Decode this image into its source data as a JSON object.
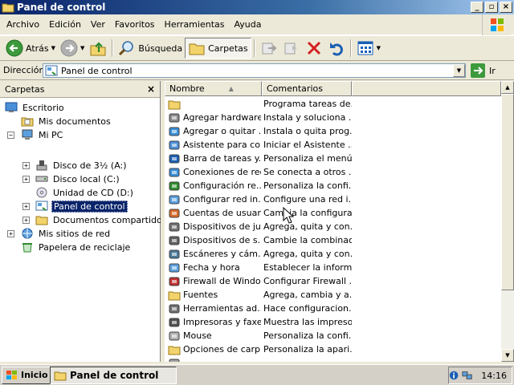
{
  "window": {
    "title": "Panel de control"
  },
  "menubar": {
    "items": [
      "Archivo",
      "Edición",
      "Ver",
      "Favoritos",
      "Herramientas",
      "Ayuda"
    ]
  },
  "toolbar": {
    "back_label": "Atrás",
    "search_label": "Búsqueda",
    "folders_label": "Carpetas"
  },
  "address": {
    "label": "Dirección",
    "value": "Panel de control",
    "go_label": "Ir"
  },
  "folders_pane": {
    "title": "Carpetas",
    "close": "×",
    "items": [
      {
        "label": "Escritorio",
        "icon": "desktop-icon"
      },
      {
        "label": "Mis documentos",
        "icon": "documents-icon"
      },
      {
        "label": "Mi PC",
        "icon": "computer-icon"
      },
      {
        "label": "Disco de 3½ (A:)",
        "icon": "floppy-icon"
      },
      {
        "label": "Disco local (C:)",
        "icon": "drive-icon"
      },
      {
        "label": "Unidad de CD (D:)",
        "icon": "cd-icon"
      },
      {
        "label": "Panel de control",
        "icon": "control-panel-icon",
        "selected": true
      },
      {
        "label": "Documentos compartidos",
        "icon": "folder-icon"
      },
      {
        "label": "Mis sitios de red",
        "icon": "network-icon"
      },
      {
        "label": "Papelera de reciclaje",
        "icon": "recycle-bin-icon"
      }
    ]
  },
  "list": {
    "columns": [
      "Nombre",
      "Comentarios"
    ],
    "rows": [
      {
        "name": "",
        "comment": "Programa tareas de...",
        "icon": "tasks-folder-icon"
      },
      {
        "name": "Agregar hardware",
        "comment": "Instala y soluciona ...",
        "icon": "hardware-icon"
      },
      {
        "name": "Agregar o quitar ...",
        "comment": "Instala o quita prog...",
        "icon": "add-remove-icon"
      },
      {
        "name": "Asistente para co...",
        "comment": "Iniciar el Asistente ...",
        "icon": "wizard-icon"
      },
      {
        "name": "Barra de tareas y...",
        "comment": "Personaliza el menú...",
        "icon": "taskbar-icon"
      },
      {
        "name": "Conexiones de red",
        "comment": "Se conecta a otros ...",
        "icon": "network-connections-icon"
      },
      {
        "name": "Configuración re...",
        "comment": "Personaliza la confi...",
        "icon": "regional-icon"
      },
      {
        "name": "Configurar red in...",
        "comment": "Configure una red i...",
        "icon": "wireless-icon"
      },
      {
        "name": "Cuentas de usuario",
        "comment": "Cambia la configura...",
        "icon": "users-icon"
      },
      {
        "name": "Dispositivos de ju...",
        "comment": "Agrega, quita y con...",
        "icon": "game-controller-icon"
      },
      {
        "name": "Dispositivos de s...",
        "comment": "Cambie la combinaci...",
        "icon": "sound-icon"
      },
      {
        "name": "Escáneres y cám...",
        "comment": "Agrega, quita y con...",
        "icon": "scanner-icon"
      },
      {
        "name": "Fecha y hora",
        "comment": "Establecer la inform...",
        "icon": "clock-icon"
      },
      {
        "name": "Firewall de Windo...",
        "comment": "Configurar Firewall ...",
        "icon": "firewall-icon"
      },
      {
        "name": "Fuentes",
        "comment": "Agrega, cambia y a...",
        "icon": "fonts-folder-icon"
      },
      {
        "name": "Herramientas ad...",
        "comment": "Hace configuracion...",
        "icon": "admin-tools-icon"
      },
      {
        "name": "Impresoras y faxes",
        "comment": "Muestra las impreso...",
        "icon": "printer-icon"
      },
      {
        "name": "Mouse",
        "comment": "Personaliza la confi...",
        "icon": "mouse-icon"
      },
      {
        "name": "Opciones de carp...",
        "comment": "Personaliza la apari...",
        "icon": "folder-options-icon"
      },
      {
        "name": "",
        "comment": "",
        "icon": "partial-icon"
      }
    ]
  },
  "taskbar": {
    "start_label": "Inicio",
    "task_label": "Panel de control",
    "clock": "14:16"
  }
}
